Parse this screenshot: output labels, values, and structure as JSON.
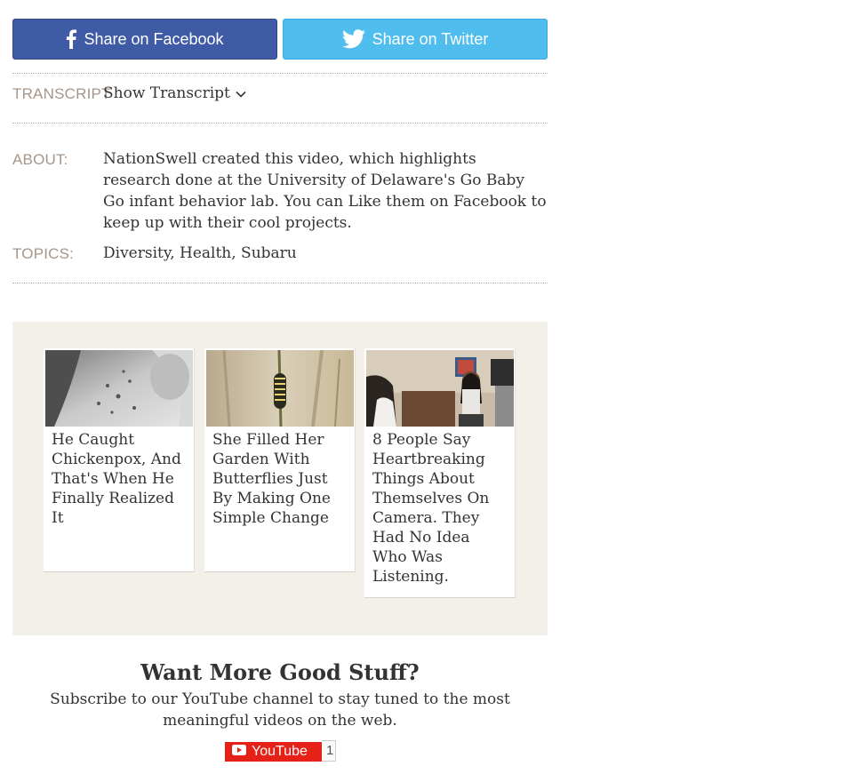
{
  "share": {
    "facebook_label": "Share on Facebook",
    "twitter_label": "Share on Twitter",
    "facebook_color": "#3f5ba6",
    "twitter_color": "#4fbdee"
  },
  "transcript": {
    "label": "TRANSCRIPT",
    "toggle_label": "Show Transcript",
    "toggle_icon": "chevron-down-icon"
  },
  "about": {
    "label": "ABOUT:",
    "text": "NationSwell created this video, which highlights research done at the University of Delaware's Go Baby Go infant behavior lab. You can Like them on Facebook to keep up with their cool projects."
  },
  "topics": {
    "label": "TOPICS:",
    "text": "Diversity, Health, Subaru"
  },
  "recommendations": [
    {
      "title": "He Caught Chickenpox, And That's When He Finally Realized It",
      "image": "chickenpox-skin-photo"
    },
    {
      "title": "She Filled Her Garden With Butterflies Just By Making One Simple Change",
      "image": "caterpillar-on-stem-photo"
    },
    {
      "title": "8 People Say Heartbreaking Things About Themselves On Camera. They Had No Idea Who Was Listening.",
      "image": "woman-on-camera-photo"
    }
  ],
  "subscribe": {
    "title": "Want More Good Stuff?",
    "text": "Subscribe to our YouTube channel to stay tuned to the most meaningful videos on the web.",
    "button_label": "YouTube",
    "count": "1",
    "button_color": "#e62117"
  }
}
